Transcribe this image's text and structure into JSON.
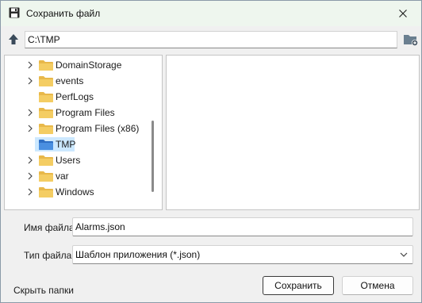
{
  "window": {
    "title": "Сохранить файл"
  },
  "toolbar": {
    "path": "C:\\TMP"
  },
  "tree": {
    "items": [
      {
        "label": "DomainStorage",
        "expandable": true
      },
      {
        "label": "events",
        "expandable": true
      },
      {
        "label": "PerfLogs",
        "expandable": false
      },
      {
        "label": "Program Files",
        "expandable": true
      },
      {
        "label": "Program Files (x86)",
        "expandable": true
      },
      {
        "label": "TMP",
        "expandable": false,
        "selected": true
      },
      {
        "label": "Users",
        "expandable": true
      },
      {
        "label": "var",
        "expandable": true
      },
      {
        "label": "Windows",
        "expandable": true
      }
    ]
  },
  "form": {
    "filename_label": "Имя файла:",
    "filename_value": "Alarms.json",
    "filetype_label": "Тип файла:",
    "filetype_value": "Шаблон приложения (*.json)"
  },
  "footer": {
    "hide_folders": "Скрыть папки",
    "save_label": "Сохранить",
    "cancel_label": "Отмена"
  },
  "colors": {
    "folder": "#e8b84a",
    "folder_selected": "#3b7fd6",
    "selection": "#cce8ff",
    "titlebar": "#eef6ee"
  },
  "icons": {
    "app": "floppy-disk-icon",
    "up": "arrow-up-icon",
    "new_folder": "new-folder-icon",
    "close": "close-icon"
  }
}
